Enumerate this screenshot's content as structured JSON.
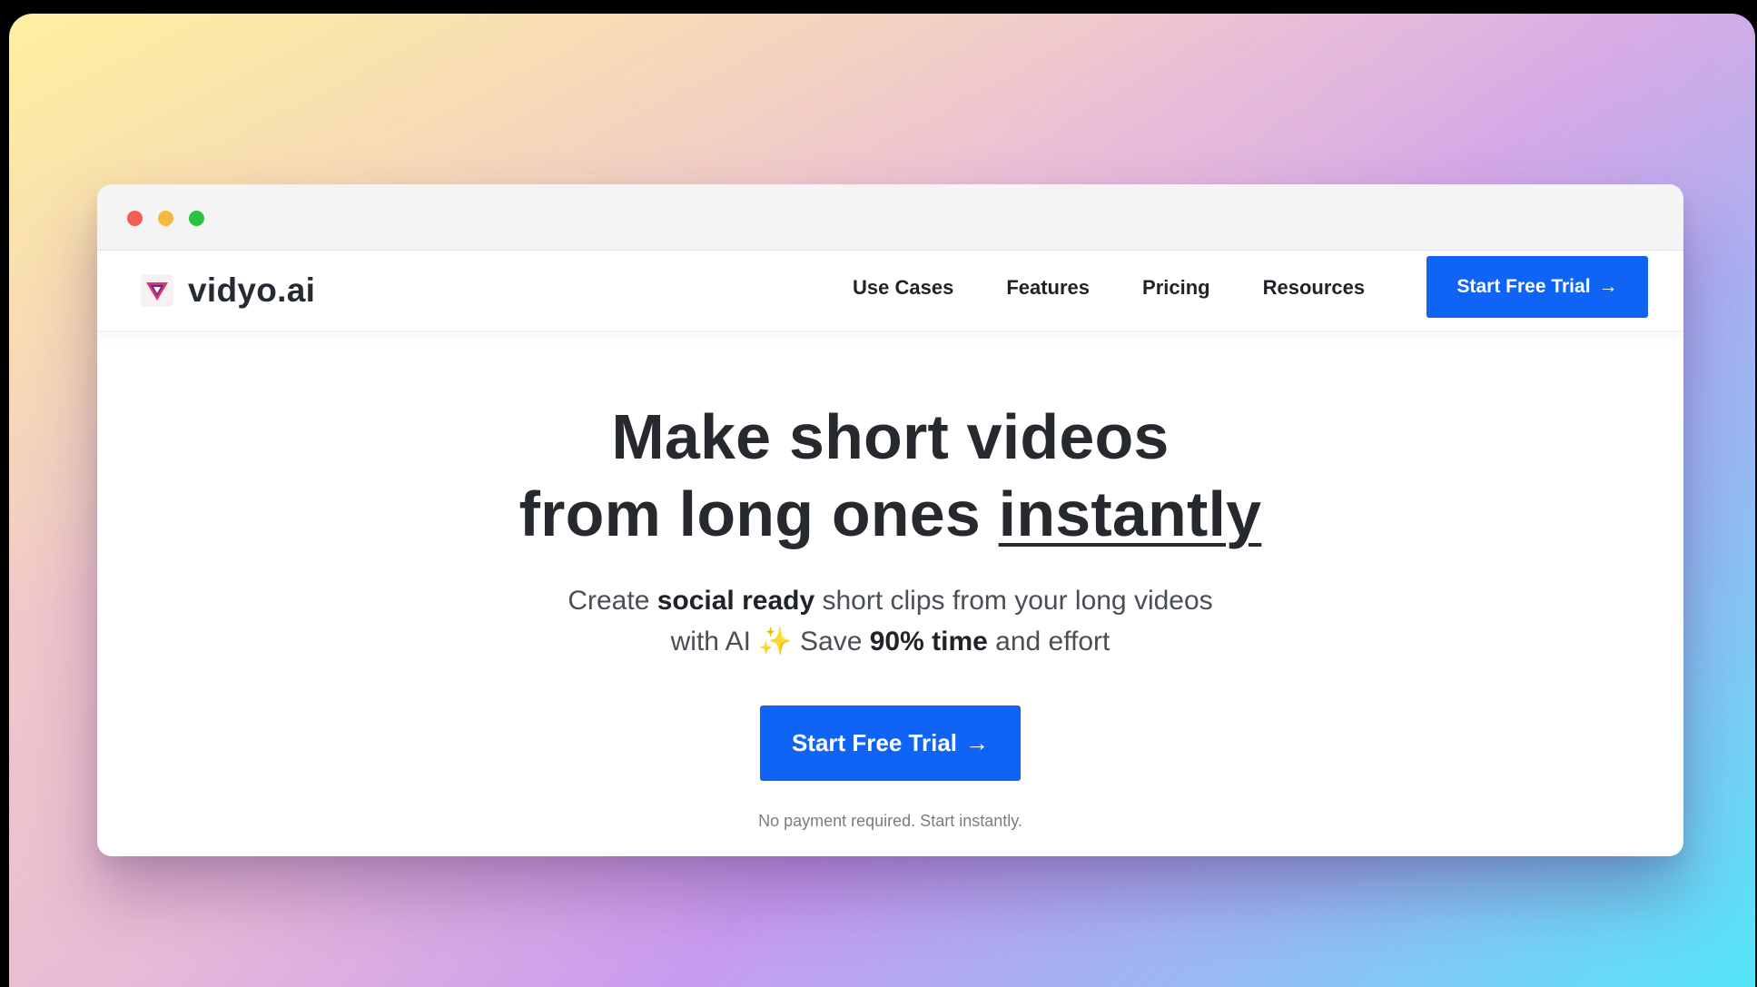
{
  "window": {
    "traffic_lights": [
      "close",
      "minimize",
      "maximize"
    ]
  },
  "brand": {
    "name": "vidyo.ai",
    "logo_icon": "vidyo-triangle-logo"
  },
  "nav": {
    "links": [
      "Use Cases",
      "Features",
      "Pricing",
      "Resources"
    ],
    "cta": "Start Free Trial",
    "cta_icon": "arrow-right-icon"
  },
  "hero": {
    "headline_line1": "Make short videos",
    "headline_line2_prefix": "from long ones ",
    "headline_line2_emphasis": "instantly",
    "sub_part1": "Create ",
    "sub_bold1": "social ready",
    "sub_part2": " short clips from your long videos with AI ",
    "sub_emoji": "✨",
    "sub_part3": " Save ",
    "sub_bold2": "90% time",
    "sub_part4": " and effort",
    "cta": "Start Free Trial",
    "note": "No payment required. Start instantly."
  },
  "colors": {
    "accent": "#0f63f5",
    "text_dark": "#26292e"
  }
}
